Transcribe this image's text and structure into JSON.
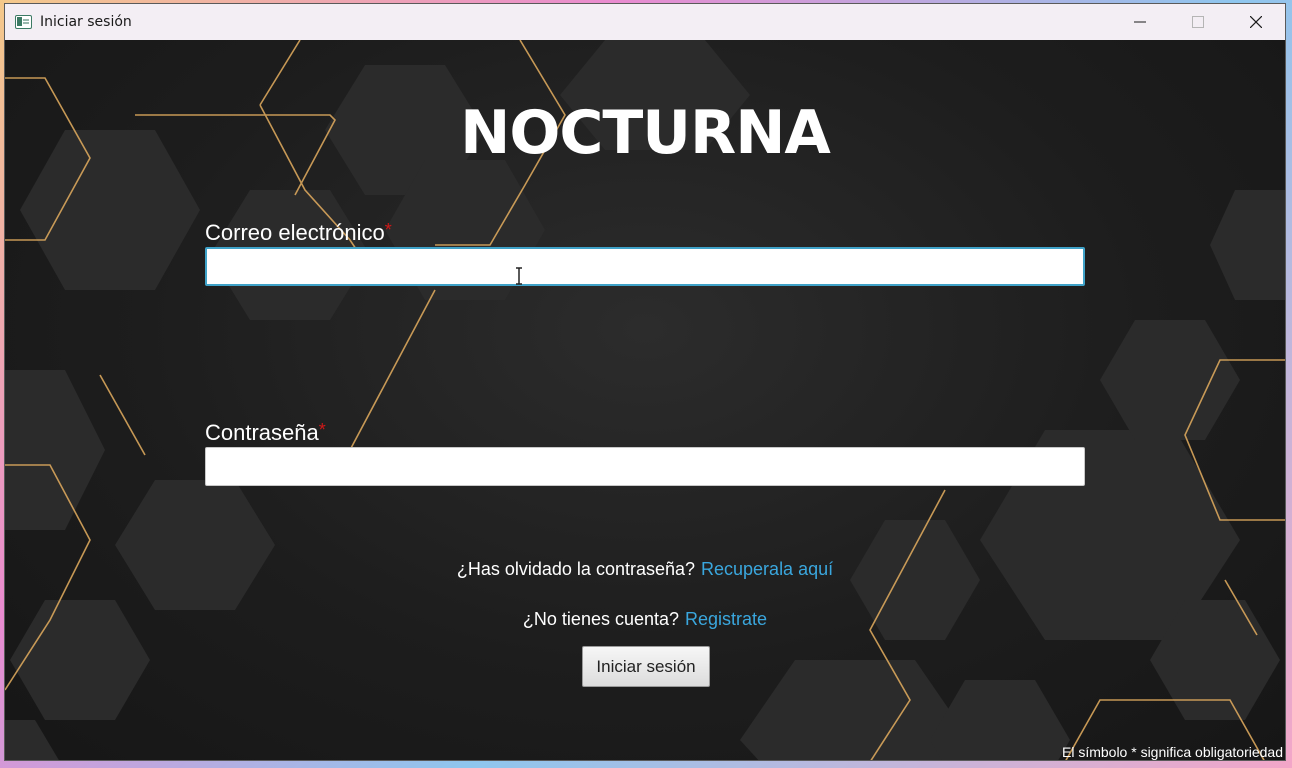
{
  "window": {
    "title": "Iniciar sesión",
    "controls": {
      "minimize": "—",
      "maximize": "☐",
      "close": "✕"
    }
  },
  "brand": {
    "name": "NOCTURNA"
  },
  "form": {
    "email_label": "Correo electrónico",
    "email_value": "",
    "password_label": "Contraseña",
    "password_value": "",
    "required_marker": "*"
  },
  "links": {
    "forgot_prompt": "¿Has olvidado la contraseña?",
    "forgot_link": "Recuperala aquí",
    "register_prompt": "¿No tienes cuenta?",
    "register_link": "Registrate"
  },
  "actions": {
    "login_label": "Iniciar sesión"
  },
  "footnote": "El símbolo * significa obligatoriedad",
  "colors": {
    "background": "#1b1b1b",
    "link": "#3aa7de",
    "required": "#d01818",
    "focus_border": "#3fa2c8",
    "gold_lines": "#d9a65c"
  }
}
